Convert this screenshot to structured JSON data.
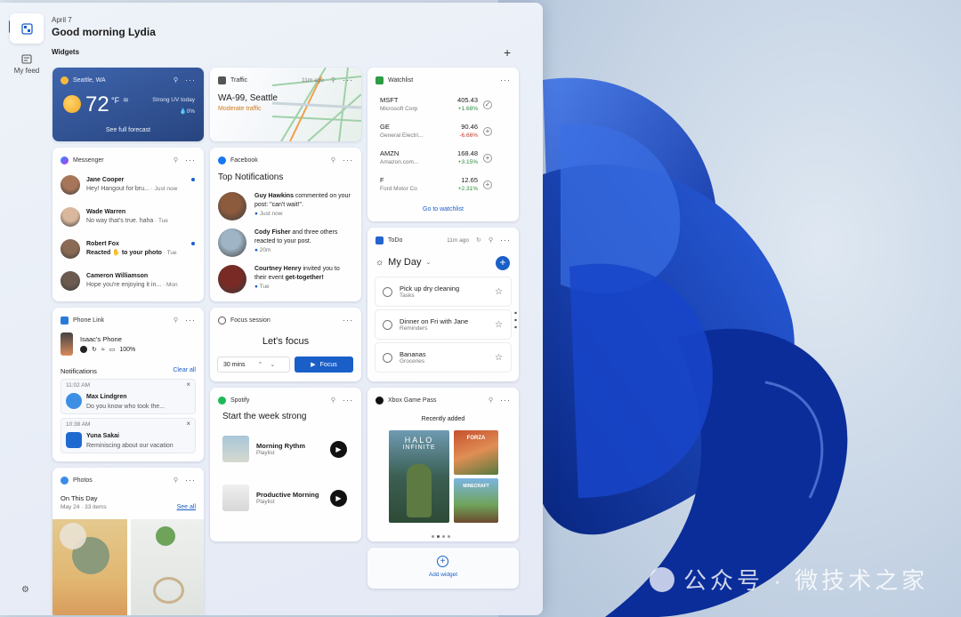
{
  "header": {
    "date": "April 7",
    "greeting": "Good morning Lydia",
    "widgets_label": "Widgets",
    "add_icon": "plus-icon"
  },
  "rail": {
    "widgets_icon": "widgets-icon",
    "feed_label": "My feed",
    "settings_icon": "gear-icon"
  },
  "weather": {
    "location": "Seattle, WA",
    "temp": "72",
    "unit": "°F",
    "condition": "Strong UV today",
    "precip": "0%",
    "link": "See full forecast"
  },
  "traffic": {
    "title": "Traffic",
    "time": "11m ago",
    "road": "WA-99, Seattle",
    "status": "Moderate traffic"
  },
  "watchlist": {
    "title": "Watchlist",
    "link": "Go to watchlist",
    "stocks": [
      {
        "sym": "MSFT",
        "name": "Microsoft Corp",
        "price": "405.43",
        "chg": "+1.68%",
        "up": true
      },
      {
        "sym": "GE",
        "name": "General Electri...",
        "price": "90.46",
        "chg": "-6.66%",
        "up": false
      },
      {
        "sym": "AMZN",
        "name": "Amazon.com...",
        "price": "168.48",
        "chg": "+3.15%",
        "up": true
      },
      {
        "sym": "F",
        "name": "Ford Motor Co",
        "price": "12.65",
        "chg": "+2.31%",
        "up": true
      }
    ]
  },
  "messenger": {
    "title": "Messenger",
    "items": [
      {
        "name": "Jane Cooper",
        "text": "Hey! Hangout for bru...",
        "time": "Just now"
      },
      {
        "name": "Wade Warren",
        "text": "No way that's true. haha",
        "time": "Tue"
      },
      {
        "name": "Robert Fox",
        "text": "Reacted ✋ to your photo",
        "time": "Tue"
      },
      {
        "name": "Cameron Williamson",
        "text": "Hope you're enjoying it in...",
        "time": "Mon"
      }
    ]
  },
  "facebook": {
    "title": "Facebook",
    "heading": "Top Notifications",
    "items": [
      {
        "name": "Guy Hawkins",
        "text": " commented on your post: \"can't wait!\".",
        "time": "Just now"
      },
      {
        "name": "Cody Fisher",
        "text": " and three others reacted to your post.",
        "time": "20m"
      },
      {
        "name": "Courtney Henry",
        "text": " invited you to their event ",
        "extra": "get-together!",
        "time": "Tue"
      }
    ]
  },
  "todo": {
    "title": "ToDo",
    "time": "11m ago",
    "list": "My Day",
    "items": [
      {
        "title": "Pick up dry cleaning",
        "sub": "Tasks"
      },
      {
        "title": "Dinner on Fri with Jane",
        "sub": "Reminders"
      },
      {
        "title": "Bananas",
        "sub": "Groceries"
      }
    ]
  },
  "phone": {
    "title": "Phone Link",
    "device": "Isaac's Phone",
    "battery": "100%",
    "notifications": "Notifications",
    "clear": "Clear all",
    "items": [
      {
        "time": "11:02 AM",
        "name": "Max Lindgren",
        "text": "Do you know who took the..."
      },
      {
        "time": "10:38 AM",
        "name": "Yuna Sakai",
        "text": "Reminiscing about our vacation"
      }
    ]
  },
  "focus": {
    "title": "Focus session",
    "heading": "Let's focus",
    "duration": "30 mins",
    "button": "Focus"
  },
  "spotify": {
    "title": "Spotify",
    "heading": "Start the week strong",
    "items": [
      {
        "name": "Morning Rythm",
        "type": "Playlist"
      },
      {
        "name": "Productive Morning",
        "type": "Playlist"
      }
    ]
  },
  "xbox": {
    "title": "Xbox Game Pass",
    "heading": "Recently added",
    "game1": "HALO",
    "game1b": "INFINITE",
    "game2": "FORZA",
    "game3": "MINECRAFT"
  },
  "photos": {
    "title": "Photos",
    "heading": "On This Day",
    "meta": "May 24 · 33 items",
    "link": "See all"
  },
  "add_widget": {
    "label": "Add widget"
  },
  "watermark": "公众号 · 微技术之家",
  "colors": {
    "accent": "#1a5fc8",
    "weather_bg": "#34569a",
    "green": "#2e8b3e",
    "red": "#c0392b"
  }
}
